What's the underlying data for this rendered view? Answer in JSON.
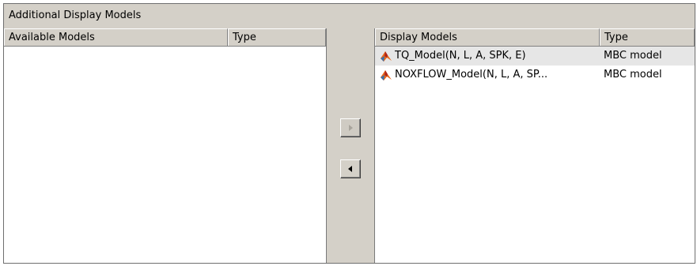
{
  "panel": {
    "title": "Additional Display Models"
  },
  "available": {
    "columns": [
      "Available Models",
      "Type"
    ],
    "rows": []
  },
  "display": {
    "columns": [
      "Display Models",
      "Type"
    ],
    "rows": [
      {
        "name": "TQ_Model(N, L, A, SPK, E)",
        "type": "MBC model",
        "selected": true
      },
      {
        "name": "NOXFLOW_Model(N, L, A, SP...",
        "type": "MBC model",
        "selected": false
      }
    ]
  },
  "buttons": {
    "add_icon": "arrow-right-icon",
    "remove_icon": "arrow-left-icon",
    "add_enabled": false
  },
  "colors": {
    "face": "#d4d0c8",
    "selection": "#e6e6e6",
    "icon_orange": "#e8671c",
    "icon_red": "#b02418"
  }
}
